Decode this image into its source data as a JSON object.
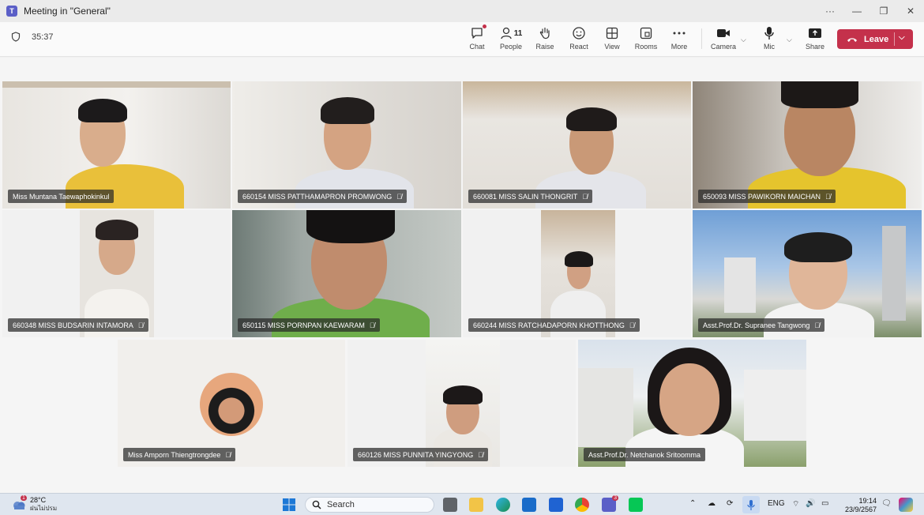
{
  "window": {
    "title": "Meeting in \"General\"",
    "controls": [
      "···",
      "—",
      "❐",
      "✕"
    ]
  },
  "toolbar": {
    "timer": "35:37",
    "tools": {
      "chat": "Chat",
      "people": "People",
      "people_count": "11",
      "raise": "Raise",
      "react": "React",
      "view": "View",
      "rooms": "Rooms",
      "more": "More",
      "camera": "Camera",
      "mic": "Mic",
      "share": "Share"
    },
    "leave": "Leave"
  },
  "participants": [
    {
      "name": "Miss Muntana Taewaphokinkul",
      "muted": false
    },
    {
      "name": "660154 MISS PATTHAMAPRON PROMWONG",
      "muted": true
    },
    {
      "name": "660081 MISS SALIN THONGRIT",
      "muted": true
    },
    {
      "name": "650093 MISS PAWIKORN MAICHAN",
      "muted": true
    },
    {
      "name": "660348 MISS BUDSARIN INTAMORA",
      "muted": true
    },
    {
      "name": "650115 MISS PORNPAN KAEWARAM",
      "muted": true
    },
    {
      "name": "660244 MISS RATCHADAPORN KHOTTHONG",
      "muted": true
    },
    {
      "name": "Asst.Prof.Dr. Supranee Tangwong",
      "muted": true
    },
    {
      "name": "Miss Amporn Thiengtrongdee",
      "muted": true
    },
    {
      "name": "660126 MISS PUNNITA YINGYONG",
      "muted": true
    },
    {
      "name": "Asst.Prof.Dr. Netchanok Sritoomma",
      "muted": false
    }
  ],
  "taskbar": {
    "weather_temp": "28°C",
    "weather_desc": "ฝนไม่ปรม",
    "weather_badge": "1",
    "search_label": "Search",
    "teams_badge": "3",
    "language": "ENG",
    "time": "19:14",
    "date": "23/9/2567"
  },
  "colors": {
    "leave": "#c4314b",
    "teams": "#5b5fc7",
    "accent_mic": "#3b78d8"
  }
}
